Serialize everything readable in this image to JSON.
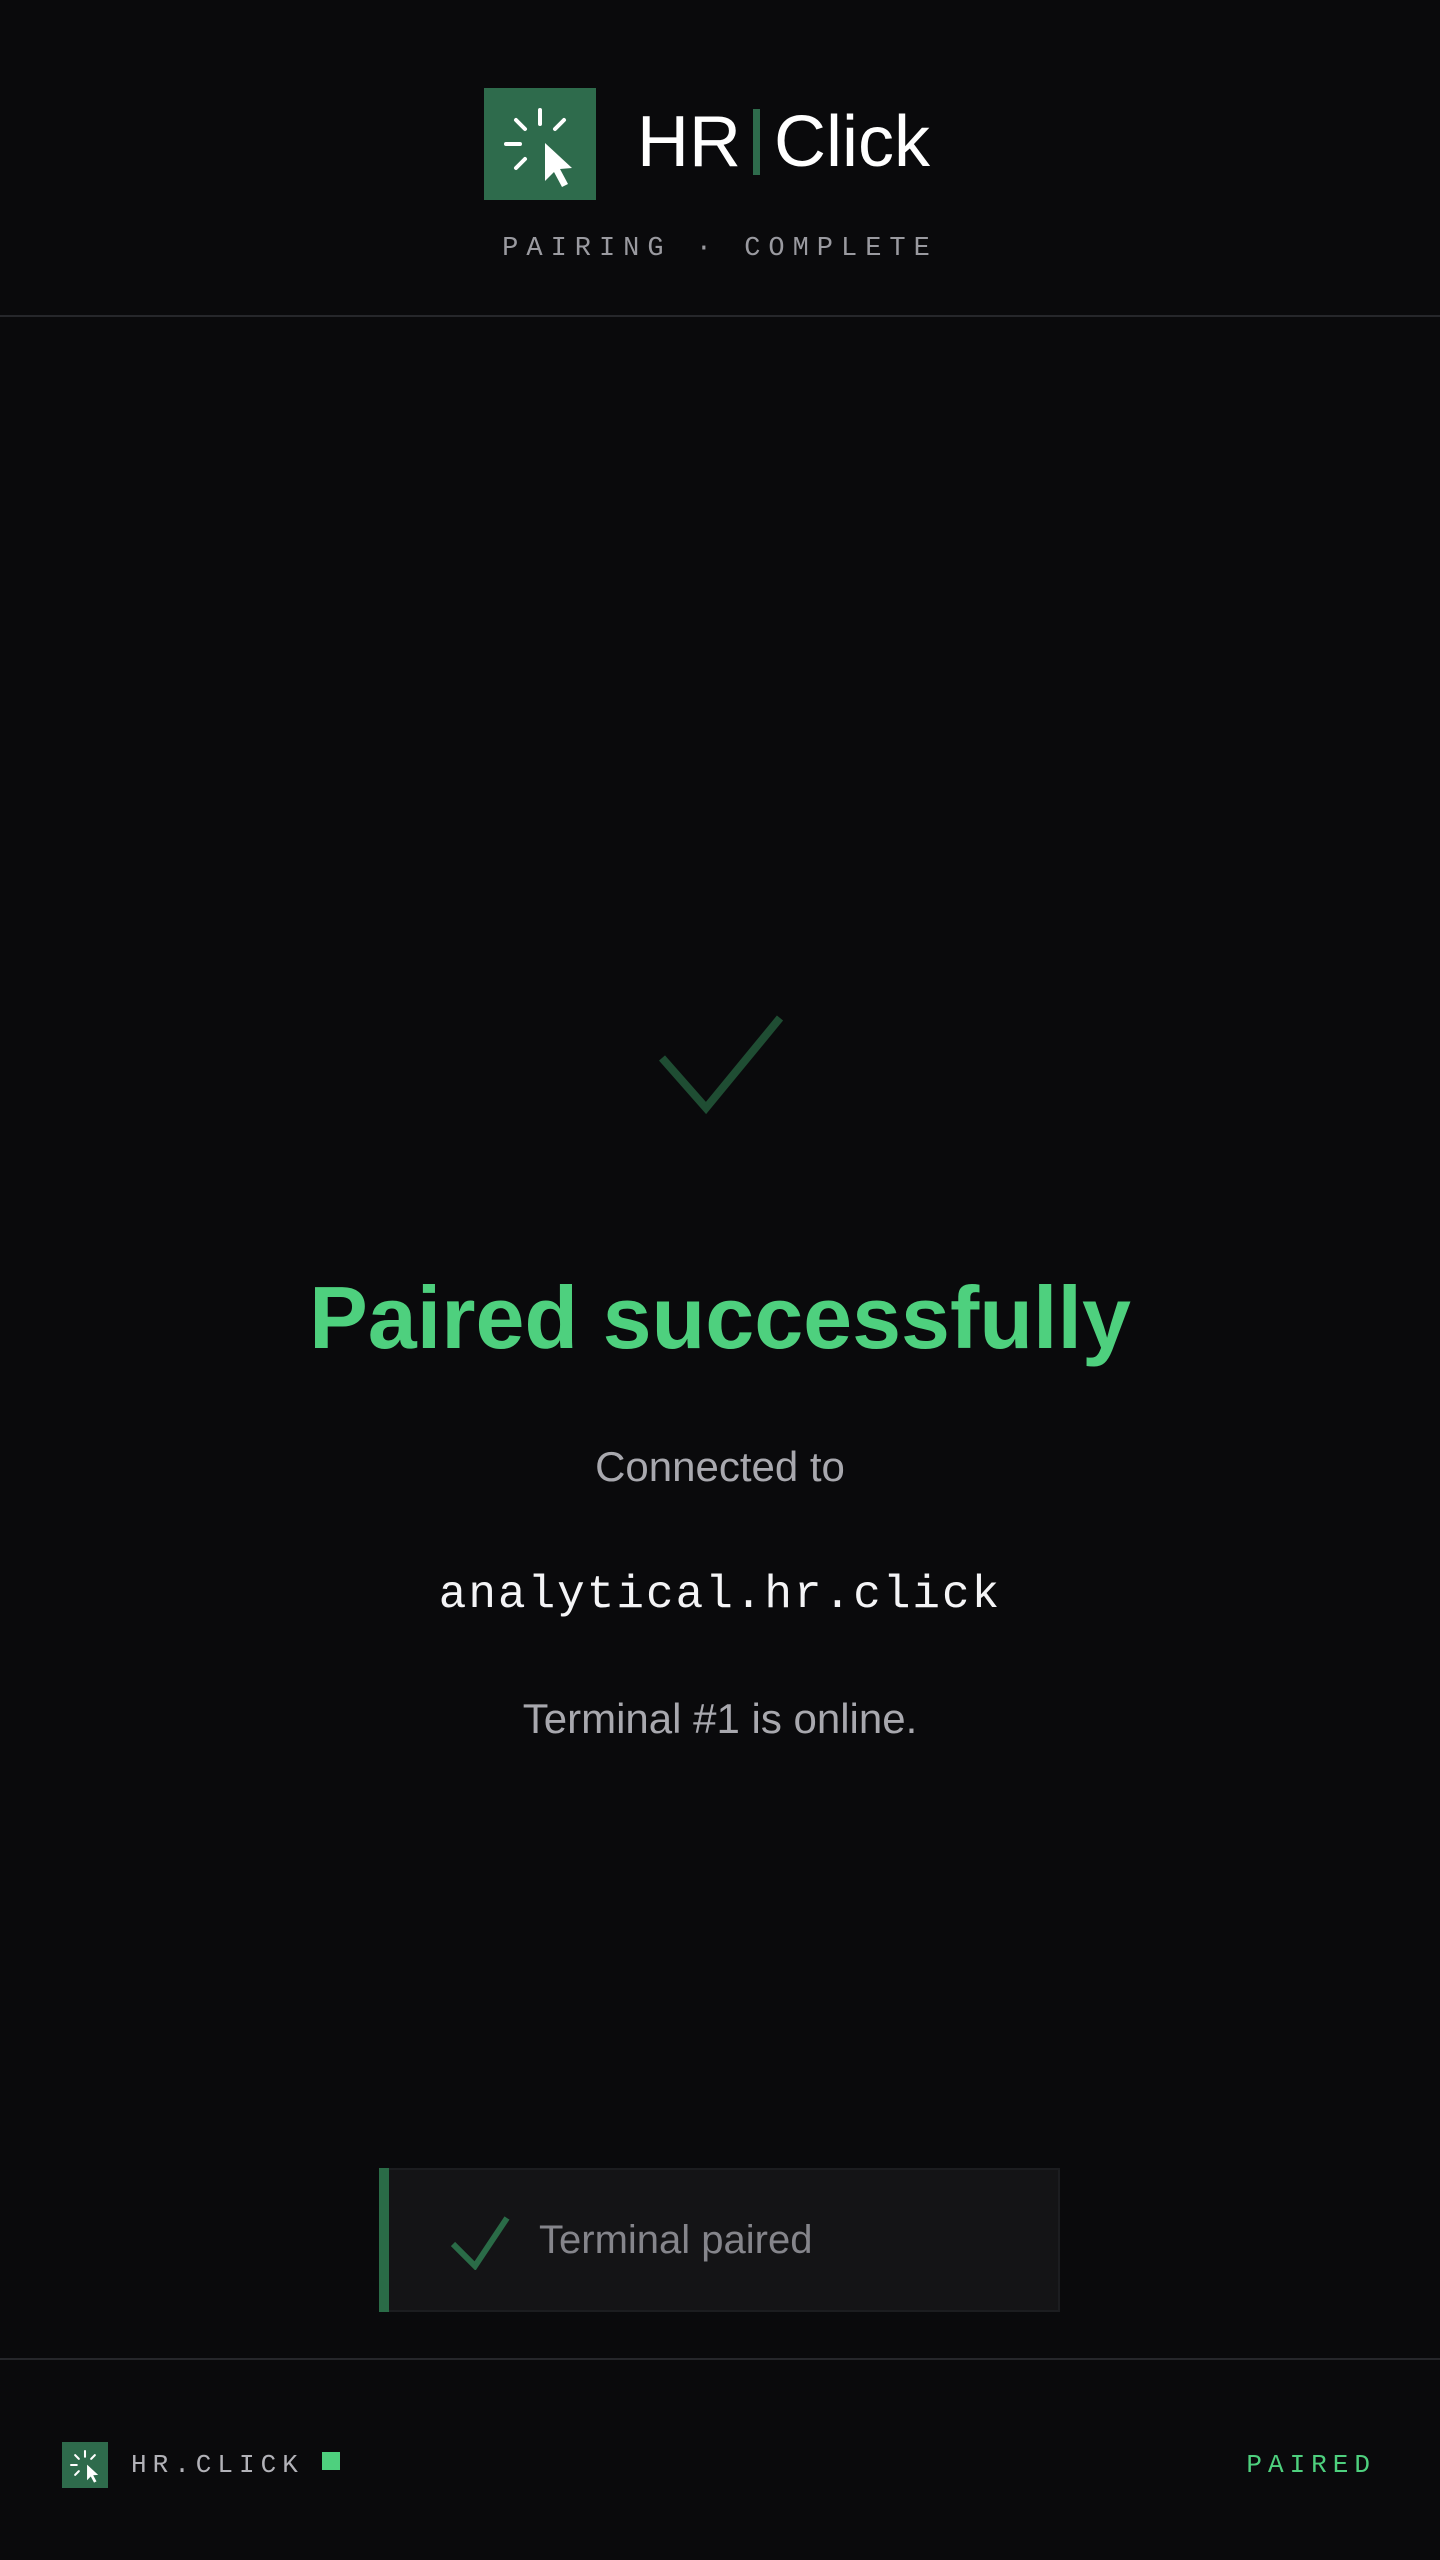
{
  "header": {
    "brand_left": "HR",
    "brand_right": "Click",
    "subtitle": "PAIRING · COMPLETE",
    "logo_icon": "cursor-click-icon"
  },
  "main": {
    "success_icon": "checkmark-icon",
    "title": "Paired successfully",
    "connected_label": "Connected to",
    "host": "analytical.hr.click",
    "status_line": "Terminal #1 is online."
  },
  "toast": {
    "icon": "checkmark-icon",
    "label": "Terminal paired"
  },
  "footer": {
    "brand": "HR.CLICK",
    "status": "PAIRED",
    "logo_icon": "cursor-click-icon"
  },
  "colors": {
    "background": "#0a0a0c",
    "brand_green": "#2e6b4c",
    "success_green": "#4ed07e",
    "muted_text": "#a8a8ae"
  }
}
